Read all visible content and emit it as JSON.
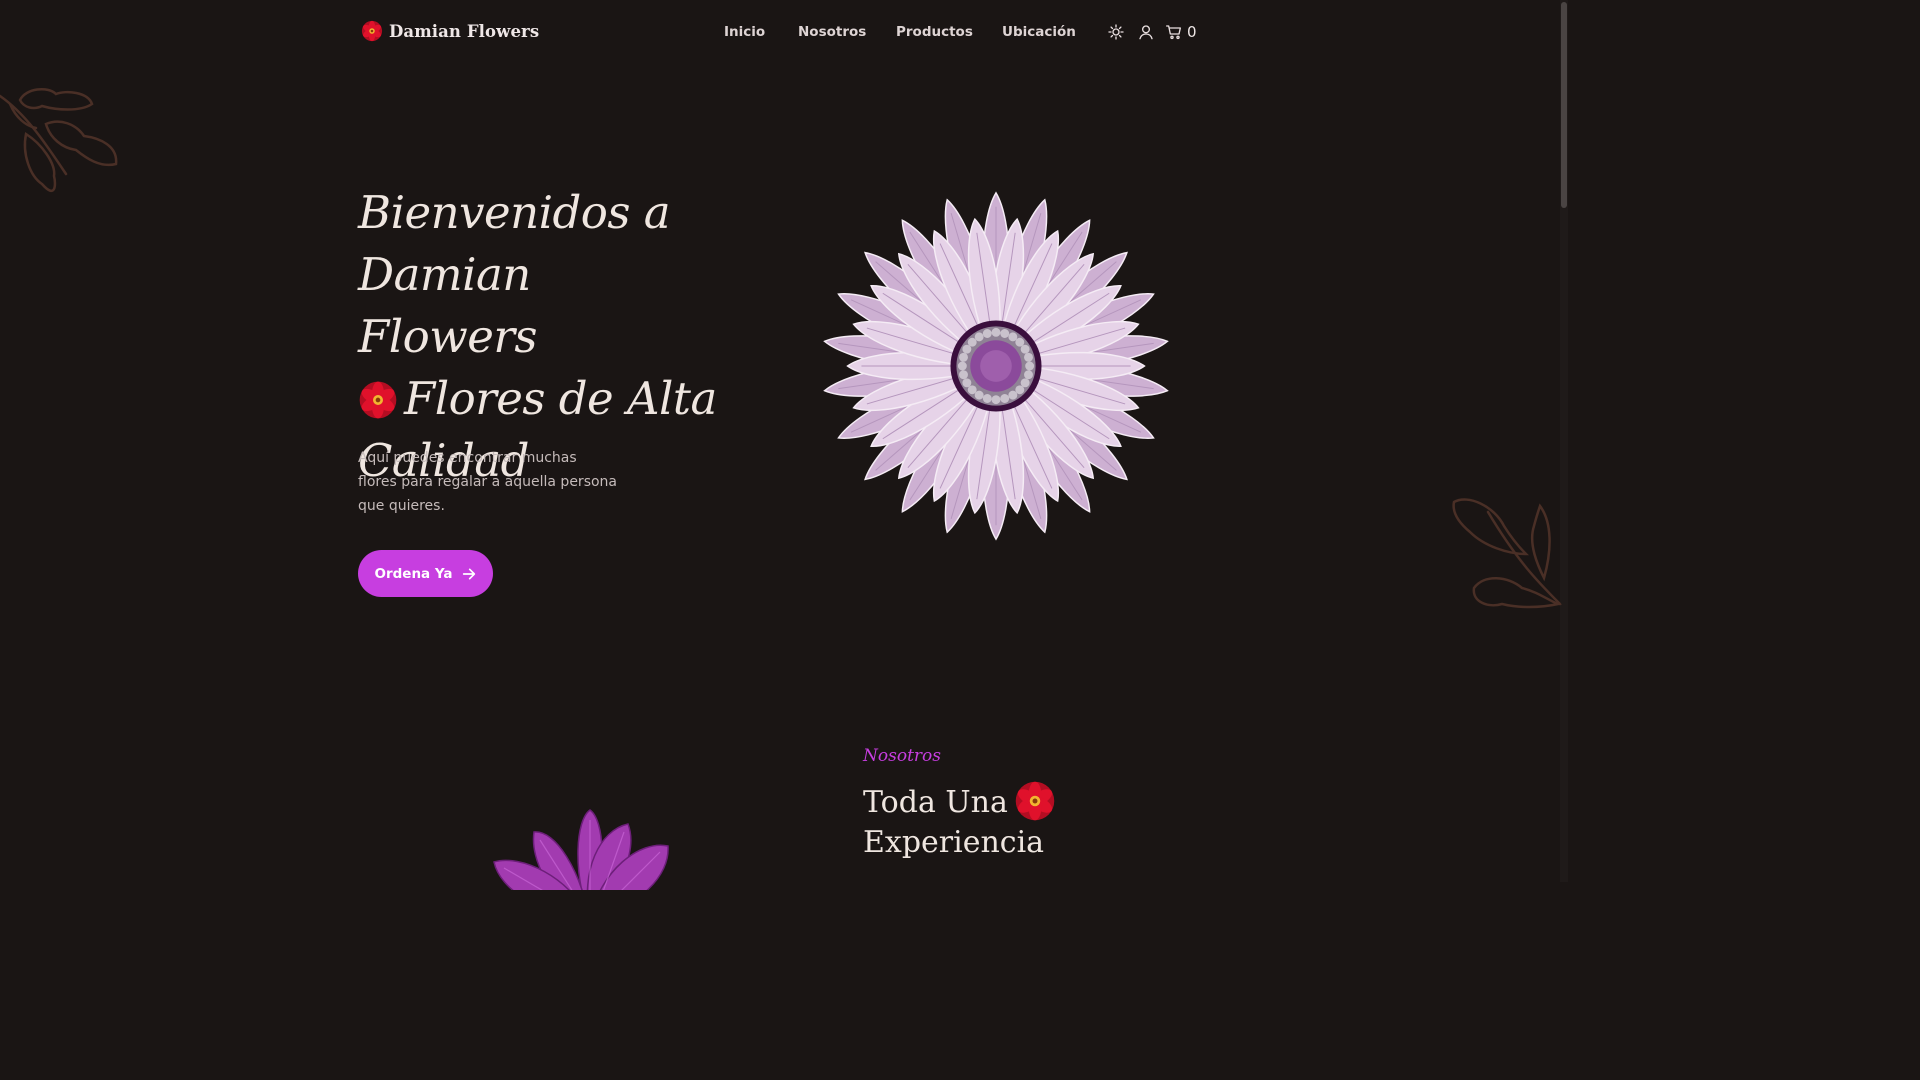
{
  "brand": {
    "name": "Damian Flowers"
  },
  "nav": {
    "items": [
      {
        "label": "Inicio"
      },
      {
        "label": "Nosotros"
      },
      {
        "label": "Productos"
      },
      {
        "label": "Ubicación"
      }
    ]
  },
  "actions": {
    "theme_icon": "sun-icon",
    "user_icon": "user-icon",
    "cart_icon": "cart-icon",
    "cart_count": "0"
  },
  "hero": {
    "title_line1": "Bienvenidos a Damian Flowers",
    "title_line2": "Flores de Alta Calidad",
    "description": "Aquí puedes encontrar muchas flores para regalar a aquella persona que quieres.",
    "cta_label": "Ordena Ya",
    "cta_icon": "arrow-right-icon"
  },
  "about": {
    "kicker": "Nosotros",
    "title_line1": "Toda Una",
    "title_line2": "Experiencia"
  },
  "colors": {
    "background": "#1a1514",
    "accent": "#c73ee0",
    "text": "#efe6e0",
    "petal": "#dcc3df",
    "leaf_outline": "#4a2f26",
    "flower_red": "#e0112b"
  }
}
